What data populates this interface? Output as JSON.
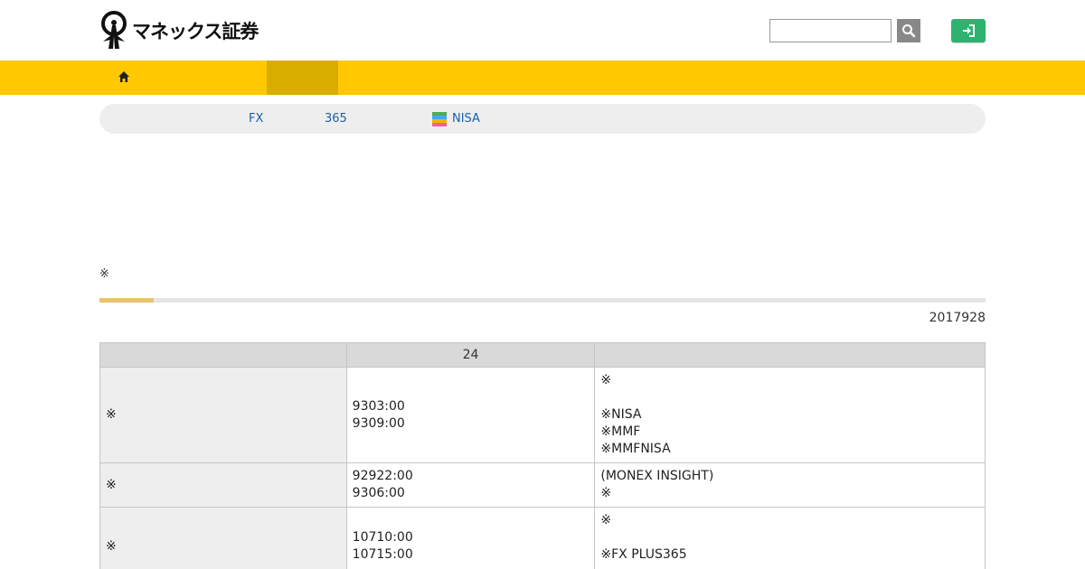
{
  "header": {
    "logo_text": "マネックス証券",
    "search": {
      "value": "",
      "placeholder": ""
    },
    "search_icon": "search-icon",
    "login_icon": "login-icon",
    "login_color": "#2db36f"
  },
  "nav": {
    "home_icon": "home-icon",
    "bar_color": "#ffc800"
  },
  "subnav": {
    "items": [
      "FX",
      "365",
      "NISA"
    ]
  },
  "note_mark": "※",
  "progress": {
    "fraction": 0.061
  },
  "date": "2017928",
  "table": {
    "headers": [
      "",
      "24",
      ""
    ],
    "rows": [
      {
        "label": "※",
        "times": [
          "9303:00",
          "9309:00"
        ],
        "notes": [
          "※",
          "",
          "※NISA",
          "※MMF",
          "※MMFNISA"
        ]
      },
      {
        "label": "※",
        "times": [
          "92922:00",
          "9306:00"
        ],
        "notes": [
          "(MONEX INSIGHT)",
          "※"
        ]
      },
      {
        "label": "※",
        "times": [
          "10710:00",
          "10715:00"
        ],
        "notes": [
          "※",
          "",
          "※FX PLUS365",
          ""
        ]
      }
    ]
  }
}
